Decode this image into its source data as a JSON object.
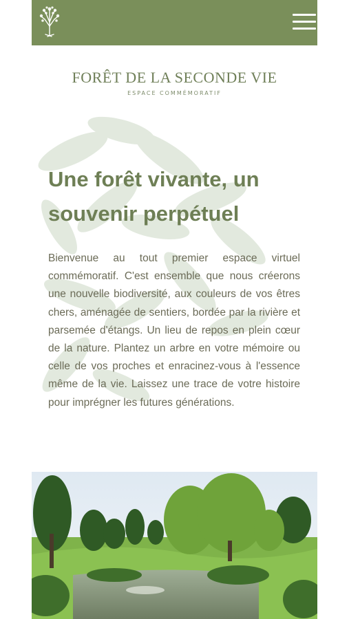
{
  "header": {
    "logo_icon": "tree-logo-icon",
    "menu_icon": "hamburger-menu-icon",
    "background_color": "#7a8f5a"
  },
  "brand": {
    "title": "FORÊT DE LA SECONDE VIE",
    "subtitle": "ESPACE COMMÉMORATIF"
  },
  "hero": {
    "headline": "Une forêt vivante, un souvenir perpétuel",
    "body": "Bienvenue au tout premier espace virtuel commémoratif. C'est ensemble que nous créerons une nouvelle biodiversité, aux couleurs de vos êtres chers, aménagée de sentiers, bordée par la rivière et parsemée d'étangs. Un lieu de repos en plein cœur de la nature. Plantez un arbre en votre mémoire ou celle de vos proches et enracinez-vous à l'essence même de la vie. Laissez une trace de votre histoire pour imprégner les futures générations."
  },
  "colors": {
    "accent": "#7a8f5a",
    "headline": "#6e7f55",
    "body_text": "#6b6b57"
  }
}
